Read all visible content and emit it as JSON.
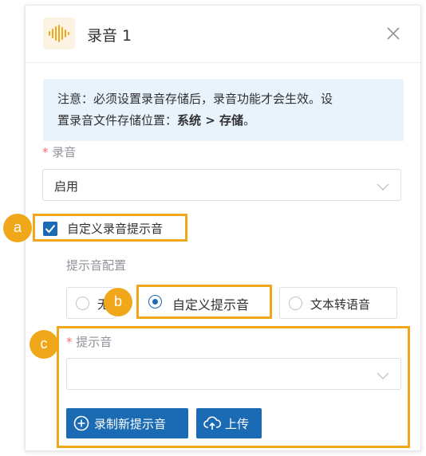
{
  "dialog": {
    "title": "录音 1",
    "icon": "audio-wave-icon",
    "accent_color": "#f0a81a",
    "primary_color": "#1a6bb3"
  },
  "notice": {
    "line1": "注意：必须设置录音存储后，录音功能才会生效。设",
    "line2_prefix": "置录音文件存储位置：",
    "line2_bold": "系统 > 存储",
    "line2_suffix": "。"
  },
  "recording": {
    "required_mark": "*",
    "label": "录音",
    "value": "启用"
  },
  "custom_prompt": {
    "checked": true,
    "label": "自定义录音提示音"
  },
  "prompt_config": {
    "label": "提示音配置",
    "options": [
      {
        "label": "无",
        "checked": false
      },
      {
        "label": "自定义提示音",
        "checked": true
      },
      {
        "label": "文本转语音",
        "checked": false
      }
    ]
  },
  "prompt": {
    "required_mark": "*",
    "label": "提示音",
    "value": ""
  },
  "buttons": {
    "record_new": "录制新提示音",
    "upload": "上传"
  },
  "callouts": {
    "a": "a",
    "b": "b",
    "c": "c"
  }
}
